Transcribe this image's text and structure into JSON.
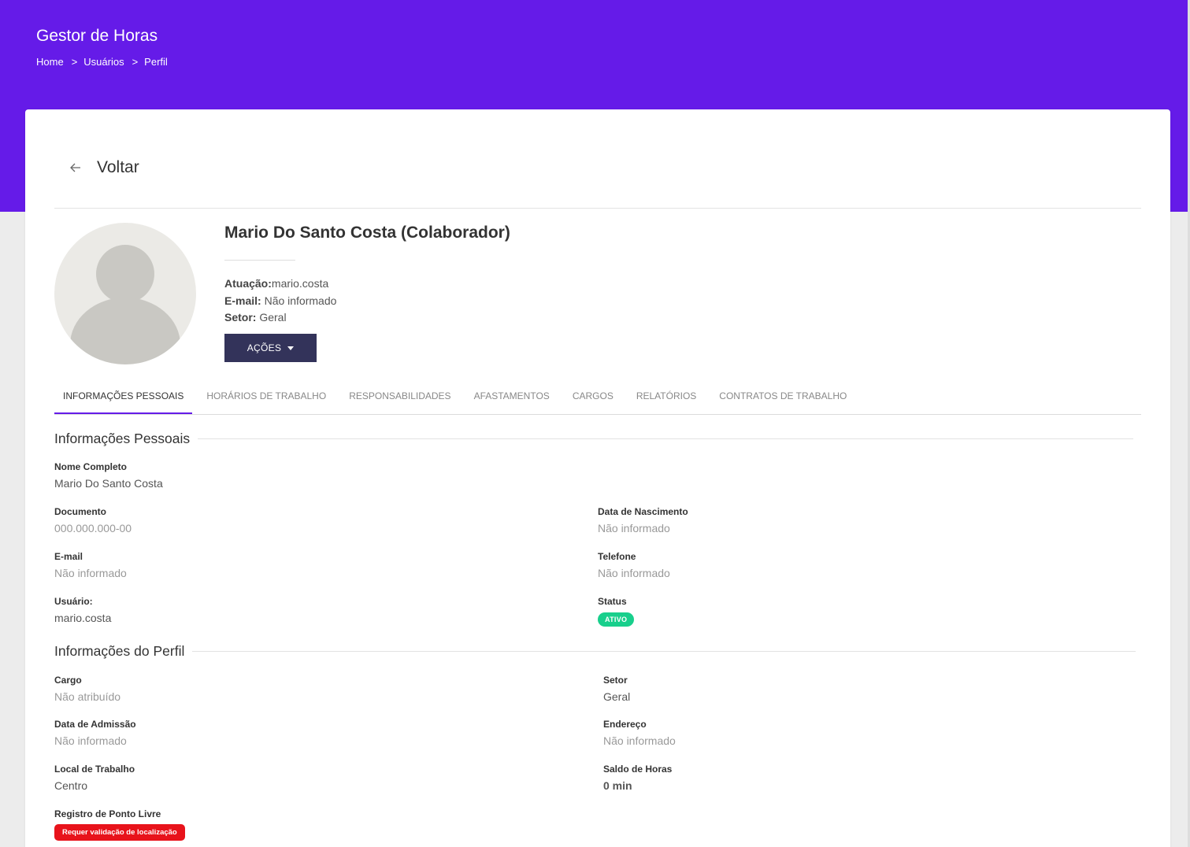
{
  "header": {
    "app_title": "Gestor de Horas",
    "breadcrumb": [
      "Home",
      "Usuários",
      "Perfil"
    ],
    "breadcrumb_sep": ">"
  },
  "back": {
    "label": "Voltar",
    "icon": "arrow-left-icon"
  },
  "profile": {
    "name": "Mario Do Santo Costa (Colaborador)",
    "atuacao_label": "Atuação:",
    "atuacao_value": "mario.costa",
    "email_label": "E-mail:",
    "email_value": "Não informado",
    "setor_label": "Setor:",
    "setor_value": "Geral",
    "actions_label": "AÇÕES"
  },
  "tabs": [
    {
      "label": "INFORMAÇÕES PESSOAIS",
      "active": true
    },
    {
      "label": "HORÁRIOS DE TRABALHO",
      "active": false
    },
    {
      "label": "RESPONSABILIDADES",
      "active": false
    },
    {
      "label": "AFASTAMENTOS",
      "active": false
    },
    {
      "label": "CARGOS",
      "active": false
    },
    {
      "label": "RELATÓRIOS",
      "active": false
    },
    {
      "label": "CONTRATOS DE TRABALHO",
      "active": false
    }
  ],
  "personal": {
    "title": "Informações Pessoais",
    "full_name_label": "Nome Completo",
    "full_name_value": "Mario Do Santo Costa",
    "document_label": "Documento",
    "document_value": "000.000.000-00",
    "birth_label": "Data de Nascimento",
    "birth_value": "Não informado",
    "email_label": "E-mail",
    "email_value": "Não informado",
    "phone_label": "Telefone",
    "phone_value": "Não informado",
    "user_label": "Usuário:",
    "user_value": "mario.costa",
    "status_label": "Status",
    "status_value": "ATIVO"
  },
  "profile_info": {
    "title": "Informações do Perfil",
    "cargo_label": "Cargo",
    "cargo_value": "Não atribuído",
    "setor_label": "Setor",
    "setor_value": "Geral",
    "admission_label": "Data de Admissão",
    "admission_value": "Não informado",
    "address_label": "Endereço",
    "address_value": "Não informado",
    "workplace_label": "Local de Trabalho",
    "workplace_value": "Centro",
    "hours_label": "Saldo de Horas",
    "hours_value": "0 min",
    "free_clock_label": "Registro de Ponto Livre",
    "free_clock_value": "Requer validação de localização"
  },
  "colors": {
    "brand": "#651be8",
    "actions_button": "#33335a",
    "status_active": "#18cf8c",
    "badge_alert": "#e8131b"
  }
}
